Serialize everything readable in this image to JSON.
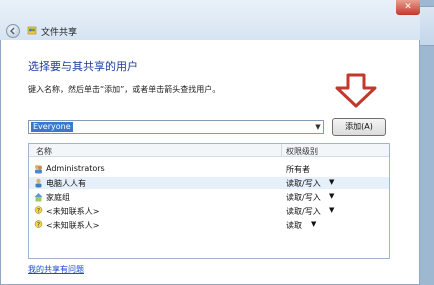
{
  "dialog": {
    "title": "文件共享",
    "heading": "选择要与其共享的用户",
    "instruction": "键入名称，然后单击“添加”，或者单击箭头查找用户。",
    "input_value": "Everyone",
    "add_label": "添加(A)",
    "close_label": "✕"
  },
  "table": {
    "headers": {
      "name": "名称",
      "permission": "权限级别"
    },
    "rows": [
      {
        "name": "Administrators",
        "permission": "所有者",
        "dropdown": "",
        "icon": "user-group-icon",
        "selected": false
      },
      {
        "name": "电脑人人有",
        "permission": "读取/写入",
        "dropdown": "▼",
        "icon": "user-icon",
        "selected": true
      },
      {
        "name": "家庭组",
        "permission": "读取/写入",
        "dropdown": "▼",
        "icon": "homegroup-icon",
        "selected": false
      },
      {
        "name": "<未知联系人>",
        "permission": "读取/写入",
        "dropdown": "▼",
        "icon": "unknown-contact-icon",
        "selected": false
      },
      {
        "name": "<未知联系人>",
        "permission": "读取",
        "dropdown": "▼",
        "icon": "unknown-contact-icon",
        "selected": false
      }
    ]
  },
  "footer": {
    "link": "我的共享有问题"
  },
  "colors": {
    "heading": "#1b3f9a",
    "link": "#1a4bd1",
    "annotation_arrow": "#c0392b",
    "selection": "#3a78d0"
  }
}
